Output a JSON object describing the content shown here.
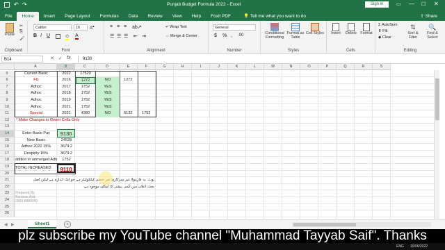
{
  "window": {
    "title": "Punjab Budget Formula 2022  -  Excel",
    "signin": "Sign in"
  },
  "tabs": [
    "File",
    "Home",
    "Insert",
    "Page Layout",
    "Formulas",
    "Data",
    "Review",
    "View",
    "Help",
    "Foxit PDF"
  ],
  "tellme": "Tell me what you want to do",
  "share": "Share",
  "ribbon": {
    "clipboard": "Clipboard",
    "paste": "Paste",
    "font_name": "Calibri",
    "font_size": "16",
    "font": "Font",
    "wrap": "Wrap Text",
    "merge": "Merge & Center",
    "alignment": "Alignment",
    "number_format": "General",
    "number": "Number",
    "cond": "Conditional Formatting",
    "fmt_table": "Format as Table",
    "cell_styles": "Cell Styles",
    "styles": "Styles",
    "insert": "Insert",
    "delete": "Delete",
    "format": "Format",
    "cells": "Cells",
    "autosum": "AutoSum",
    "fill": "Fill",
    "clear": "Clear",
    "sort": "Sort & Filter",
    "find": "Find & Select",
    "editing": "Editing"
  },
  "formula": {
    "namebox": "B14",
    "fx": "fx",
    "value": "9130"
  },
  "columns": [
    "A",
    "B",
    "C",
    "D",
    "E",
    "F",
    "G",
    "H",
    "I",
    "J",
    "K",
    "L",
    "M",
    "N",
    "O",
    "P",
    "Q",
    "R",
    "S"
  ],
  "rows": [
    "5",
    "6",
    "7",
    "8",
    "9",
    "10",
    "11",
    "12",
    "13",
    "14",
    "15",
    "16",
    "17",
    "18",
    "19",
    "20",
    "21",
    "22",
    "23",
    "24",
    "25",
    "26",
    "27"
  ],
  "cells": {
    "r5": {
      "a": "Current Basic",
      "b": "2022",
      "c": "17520"
    },
    "r6": {
      "a": "Fix",
      "b": "2016",
      "c": "1272",
      "d": "NO",
      "e": "1272"
    },
    "r7": {
      "a": "Adhoc",
      "b": "2017",
      "c": "1752",
      "d": "YES"
    },
    "r8": {
      "a": "Adhoc",
      "b": "2018",
      "c": "1752",
      "d": "YES"
    },
    "r9": {
      "a": "Adhoc",
      "b": "2019",
      "c": "1752",
      "d": "YES"
    },
    "r10": {
      "a": "Adhoc",
      "b": "2021",
      "c": "1752",
      "d": "YES"
    },
    "r11": {
      "a": "Special",
      "b": "2021",
      "c": "4380",
      "d": "NO",
      "e": "6132",
      "f": "1752"
    },
    "r12": {
      "a": "* Make Changes in Green Cells Only"
    },
    "r14": {
      "a": "Enter Basic Pay",
      "b": "9130"
    },
    "r15": {
      "a": "New Basic",
      "b": "24528"
    },
    "r16": {
      "a": "Adhoc 2022 15%",
      "b": "3679.2"
    },
    "r17": {
      "a": "Despirity 15%",
      "b": "3679.2"
    },
    "r18": {
      "a": "ddition in unmerged Adhoc",
      "b": "1752"
    },
    "r20": {
      "a": "TOTAL INCREASED",
      "b": "9110"
    },
    "r22": {
      "a": "نوٹ: یہ فارمولا غیر سرکاری غیر حتمی کیلکولیٹر ہے جو ایک اندازہ ہے لیکن اصل"
    },
    "r23": {
      "a": "بجٹ اعلان میں کمی بیشی کا امکان موجود ہے"
    },
    "r24": {
      "a": "Prepared By"
    },
    "r25": {
      "a": "Banaras Aziz"
    },
    "r26": {
      "a": "0300-8880000"
    }
  },
  "sheet": {
    "name": "Sheet1",
    "add": "+"
  },
  "caption": "plz subscribe my YouTube channel \"Muhammad Tayyab Saif\". Thanks",
  "taskbar": {
    "lang": "ENG",
    "date": "15/06/2022"
  },
  "colors": {
    "excel_green": "#217346",
    "cell_green": "#c6efce",
    "red_text": "#c00000"
  }
}
